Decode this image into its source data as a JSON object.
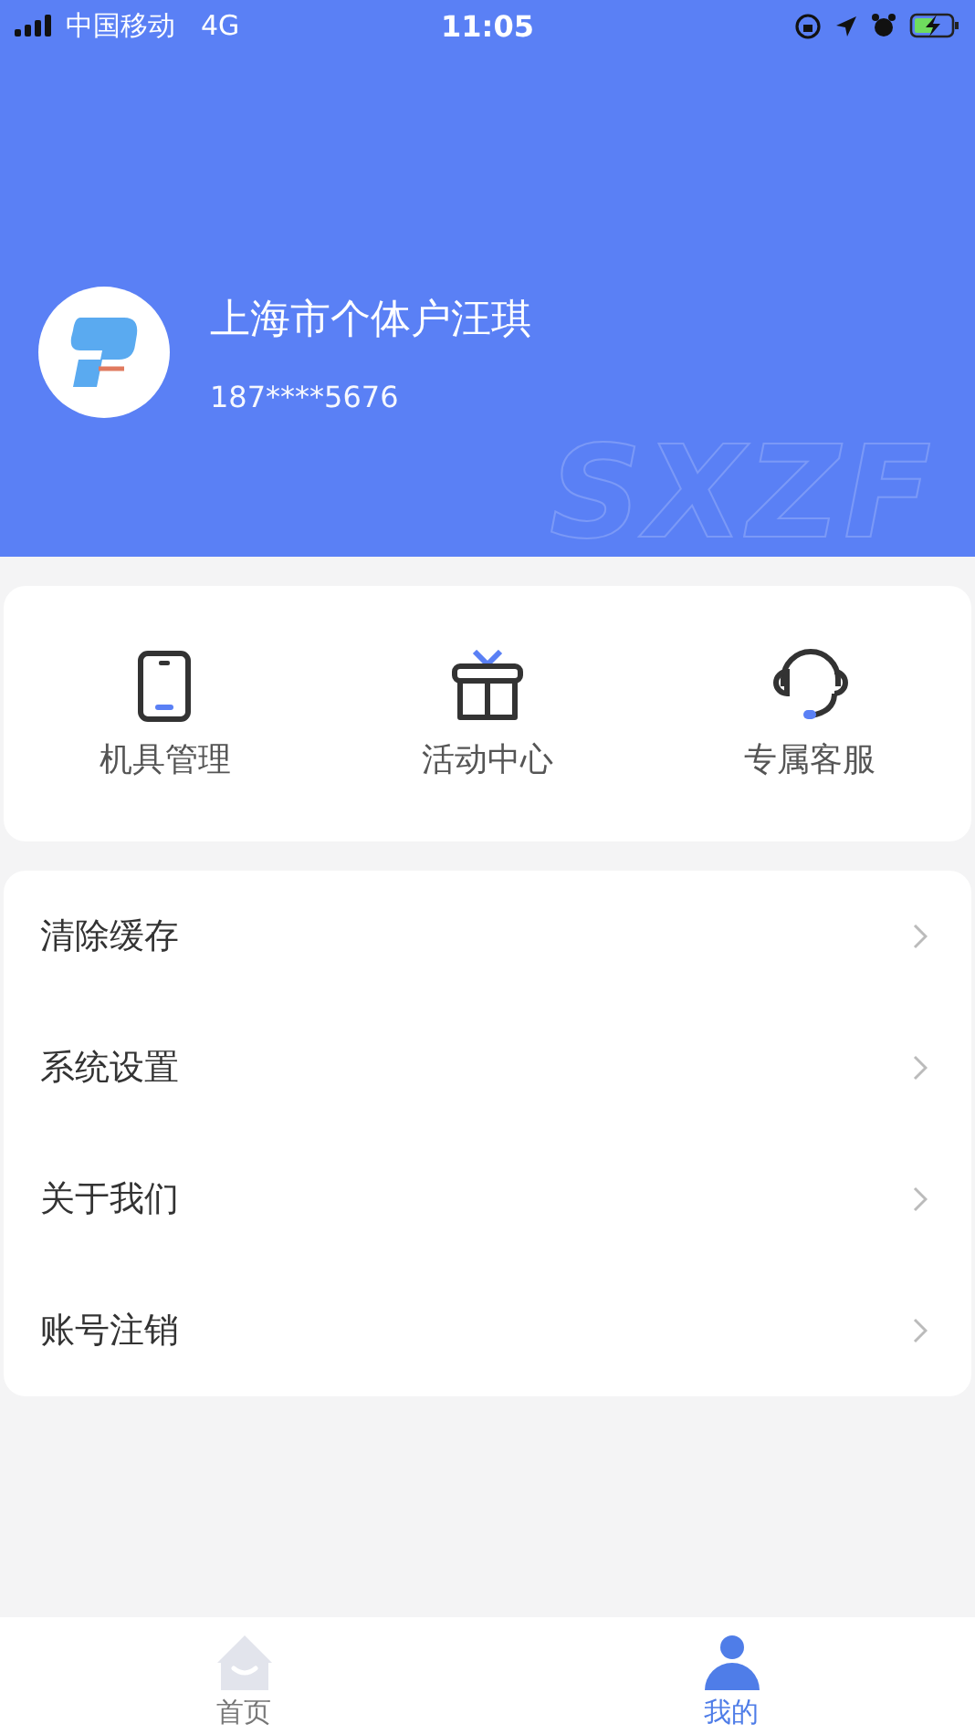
{
  "status_bar": {
    "carrier": "中国移动",
    "network": "4G",
    "time": "11:05"
  },
  "profile": {
    "name": "上海市个体户汪琪",
    "phone": "187****5676",
    "backdrop_text": "SXZF"
  },
  "shortcuts": [
    {
      "kind": "device",
      "label": "机具管理"
    },
    {
      "kind": "gift",
      "label": "活动中心"
    },
    {
      "kind": "headset",
      "label": "专属客服"
    }
  ],
  "menu": [
    {
      "label": "清除缓存"
    },
    {
      "label": "系统设置"
    },
    {
      "label": "关于我们"
    },
    {
      "label": "账号注销"
    }
  ],
  "tabs": [
    {
      "kind": "home",
      "label": "首页",
      "selected": false
    },
    {
      "kind": "user",
      "label": "我的",
      "selected": true
    }
  ]
}
